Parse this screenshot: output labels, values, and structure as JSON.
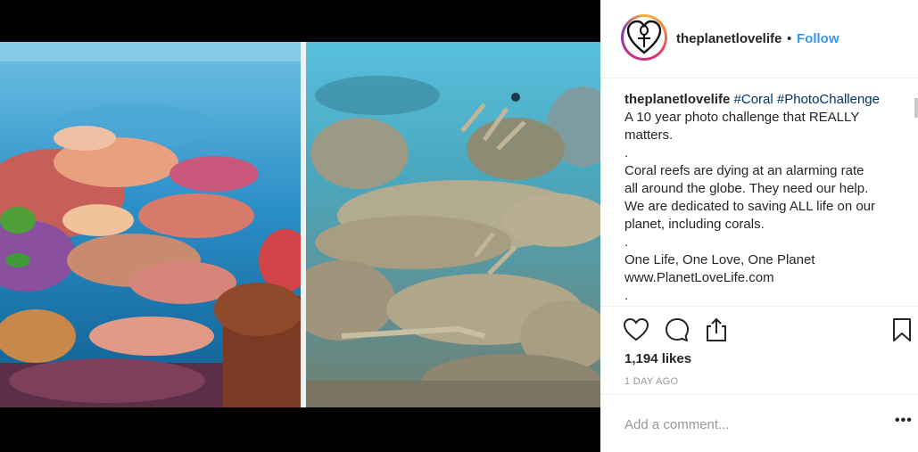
{
  "post": {
    "username": "theplanetlovelife",
    "separator": "•",
    "follow_label": "Follow",
    "media": {
      "before_alt": "Healthy colorful coral reef",
      "after_alt": "Bleached dead coral reef"
    },
    "caption": {
      "username": "theplanetlovelife",
      "hashtags": [
        "#Coral",
        "#PhotoChallenge"
      ],
      "lines": [
        "A 10 year photo challenge that REALLY",
        "matters.",
        ".",
        "Coral reefs are dying at an alarming rate",
        "all around the globe. They need our help.",
        "We are dedicated to saving ALL life on our",
        "planet, including corals.",
        ".",
        "One Life, One Love, One Planet",
        "www.PlanetLoveLife.com",
        "."
      ]
    },
    "actions": {
      "like_icon": "heart-icon",
      "comment_icon": "comment-icon",
      "share_icon": "share-icon",
      "save_icon": "bookmark-icon"
    },
    "likes": "1,194 likes",
    "time_ago": "1 DAY AGO",
    "comment_placeholder": "Add a comment...",
    "more_options": "•••",
    "colors": {
      "link_blue": "#3897f0",
      "hashtag": "#003569",
      "text": "#262626",
      "muted": "#999999"
    }
  }
}
